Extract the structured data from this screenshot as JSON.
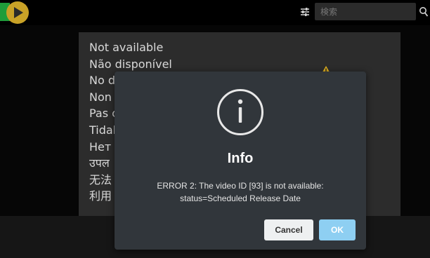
{
  "search": {
    "placeholder": "検索"
  },
  "icons": {
    "logo": "play-logo-icon",
    "filter": "sliders-icon",
    "search": "search-icon",
    "warning": "warning-icon",
    "info": "info-circle-icon"
  },
  "colors": {
    "modal_bg": "#31363b",
    "ok_button": "#8ecff2",
    "cancel_button": "#eef0f1",
    "logo_gold": "#c9a227",
    "logo_green": "#1f9d3a"
  },
  "unavailable_messages": [
    "Not available",
    "Não disponível",
    "No d",
    "Non",
    "Pas c",
    "Tidak",
    "Нет n",
    "उपल",
    "无法",
    "利用"
  ],
  "dialog": {
    "title": "Info",
    "message_line1": "ERROR 2: The video ID [93] is not available:",
    "message_line2": "status=Scheduled Release Date",
    "cancel_label": "Cancel",
    "ok_label": "OK"
  }
}
